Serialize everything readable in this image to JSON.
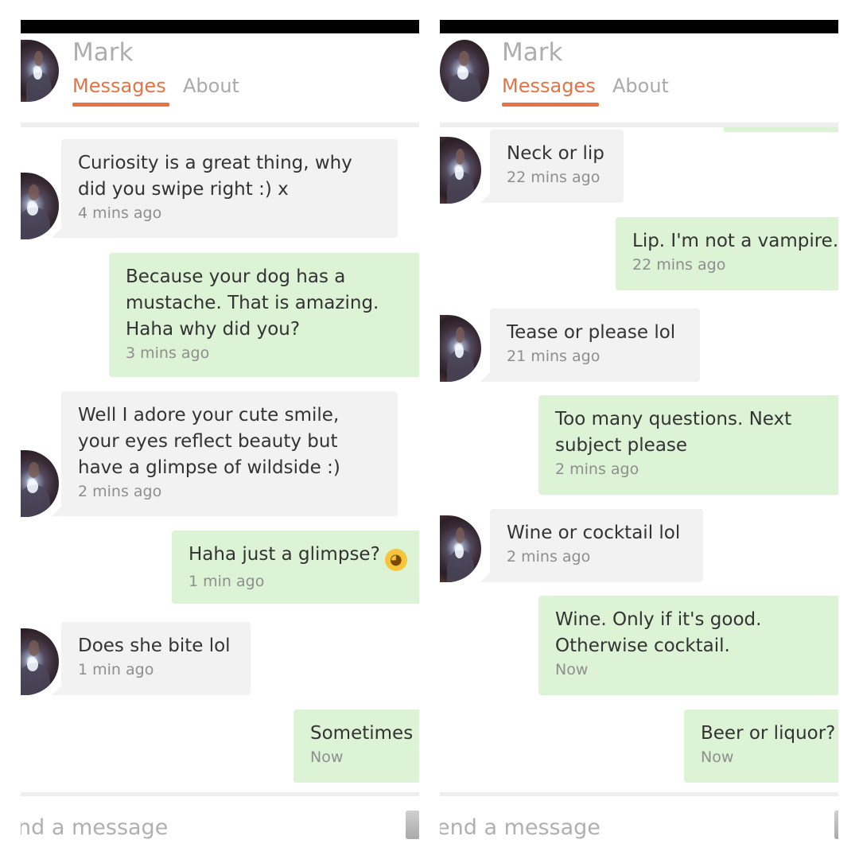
{
  "left": {
    "contact_name": "Mark",
    "tabs": {
      "messages": "Messages",
      "about": "About"
    },
    "messages": [
      {
        "dir": "in",
        "text": "Curiosity is a great thing, why\ndid you swipe right :) x",
        "time": "4 mins ago"
      },
      {
        "dir": "out",
        "text": "Because your dog has a\nmustache. That is amazing.\nHaha why did you?",
        "time": "3 mins ago"
      },
      {
        "dir": "in",
        "text": "Well I adore your cute smile,\nyour eyes reflect beauty but\nhave a glimpse of wildside :)",
        "time": "2 mins ago"
      },
      {
        "dir": "out",
        "text": "Haha just a glimpse?",
        "time": "1 min ago",
        "emoji": "winking-face"
      },
      {
        "dir": "in",
        "text": "Does she bite lol",
        "time": "1 min ago"
      },
      {
        "dir": "out",
        "text": "Sometimes",
        "time": "Now"
      }
    ],
    "composer_placeholder": "nd a message"
  },
  "right": {
    "contact_name": "Mark",
    "tabs": {
      "messages": "Messages",
      "about": "About"
    },
    "messages": [
      {
        "dir": "in",
        "text": "Neck or lip",
        "time": "22 mins ago"
      },
      {
        "dir": "out",
        "text": "Lip. I'm not a vampire.",
        "time": "22 mins ago"
      },
      {
        "dir": "in",
        "text": "Tease or please lol",
        "time": "21 mins ago"
      },
      {
        "dir": "out",
        "text": "Too many questions. Next\nsubject please",
        "time": "2 mins ago"
      },
      {
        "dir": "in",
        "text": "Wine or cocktail lol",
        "time": "2 mins ago"
      },
      {
        "dir": "out",
        "text": "Wine. Only if it's good.\nOtherwise cocktail.",
        "time": "Now"
      },
      {
        "dir": "out",
        "text": "Beer or liquor?",
        "time": "Now"
      }
    ],
    "composer_placeholder": "end a message"
  },
  "colors": {
    "accent": "#e27445",
    "incoming_bubble": "#f2f2f2",
    "outgoing_bubble": "#ddf3d6"
  }
}
